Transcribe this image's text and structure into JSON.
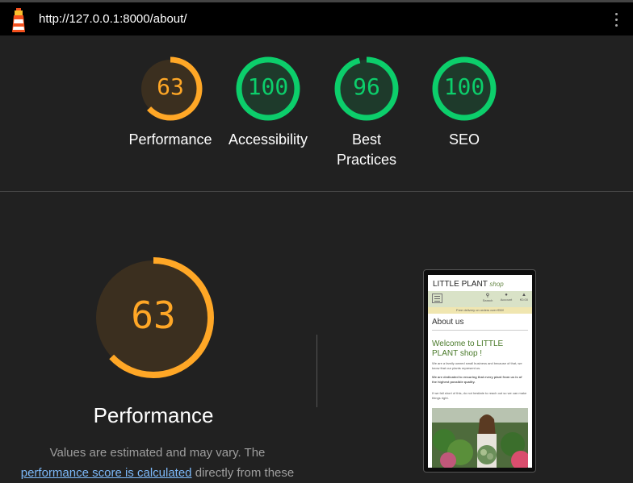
{
  "browser": {
    "url": "http://127.0.0.1:8000/about/"
  },
  "scores": [
    {
      "label": "Performance",
      "value": "63",
      "fraction": 0.63,
      "color": "#ffa726",
      "fill": "#3b2f1f"
    },
    {
      "label": "Accessibility",
      "value": "100",
      "fraction": 1.0,
      "color": "#0cce6b",
      "fill": "#1e3a2b"
    },
    {
      "label": "Best Practices",
      "value": "96",
      "fraction": 0.96,
      "color": "#0cce6b",
      "fill": "#1e3a2b"
    },
    {
      "label": "SEO",
      "value": "100",
      "fraction": 1.0,
      "color": "#0cce6b",
      "fill": "#1e3a2b"
    }
  ],
  "performance": {
    "title": "Performance",
    "score": "63",
    "description_prefix": "Values are estimated and may vary. The",
    "link_text": "performance score is calculated",
    "description_suffix": "directly from these"
  },
  "preview": {
    "brand": "LITTLE PLANT",
    "brand_sub": "shop",
    "nav_search": "Search",
    "nav_account": "Account",
    "nav_price": "€0.00",
    "delivery": "Free delivery on orders over €50!",
    "heading": "About us",
    "welcome": "Welcome to LITTLE PLANT shop !",
    "p1": "We are a family owned small business and because of that, we know that our plants represent us.",
    "p2": "We are dedicated to ensuring that every plant from us is of the highest possible quality.",
    "p3": "If we fall short of this, do not hesitate to reach out so we can make things right."
  }
}
